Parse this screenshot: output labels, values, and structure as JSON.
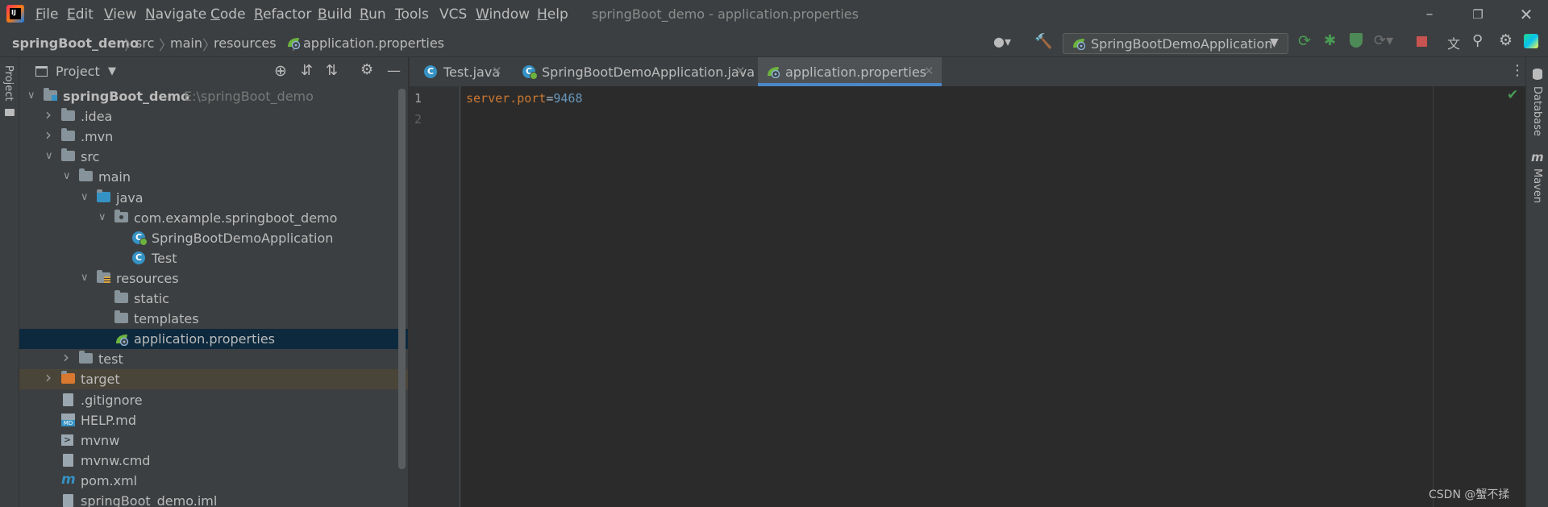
{
  "menu": {
    "items": [
      "File",
      "Edit",
      "View",
      "Navigate",
      "Code",
      "Refactor",
      "Build",
      "Run",
      "Tools",
      "VCS",
      "Window",
      "Help"
    ],
    "mnemonics": [
      "F",
      "E",
      "V",
      "N",
      "C",
      "R",
      "B",
      "R",
      "T",
      "",
      "W",
      "H"
    ]
  },
  "window_title": "springBoot_demo - application.properties",
  "breadcrumbs": [
    "springBoot_demo",
    "src",
    "main",
    "resources",
    "application.properties"
  ],
  "run_config": "SpringBootDemoApplication",
  "left_stripe": {
    "project_label": "Project"
  },
  "right_stripe": {
    "database_label": "Database",
    "maven_label": "Maven"
  },
  "project_panel": {
    "title": "Project",
    "tree": [
      {
        "label": "springBoot_demo",
        "path": "E:\\springBoot_demo",
        "depth": 0,
        "expanded": true,
        "icon": "module-folder-icon"
      },
      {
        "label": ".idea",
        "depth": 1,
        "expanded": false,
        "icon": "folder-icon"
      },
      {
        "label": ".mvn",
        "depth": 1,
        "expanded": false,
        "icon": "folder-icon"
      },
      {
        "label": "src",
        "depth": 1,
        "expanded": true,
        "icon": "folder-icon"
      },
      {
        "label": "main",
        "depth": 2,
        "expanded": true,
        "icon": "folder-icon"
      },
      {
        "label": "java",
        "depth": 3,
        "expanded": true,
        "icon": "source-folder-icon"
      },
      {
        "label": "com.example.springboot_demo",
        "depth": 4,
        "expanded": true,
        "icon": "package-icon"
      },
      {
        "label": "SpringBootDemoApplication",
        "depth": 5,
        "icon": "spring-class-icon"
      },
      {
        "label": "Test",
        "depth": 5,
        "icon": "class-icon"
      },
      {
        "label": "resources",
        "depth": 3,
        "expanded": true,
        "icon": "resource-folder-icon"
      },
      {
        "label": "static",
        "depth": 4,
        "icon": "folder-icon"
      },
      {
        "label": "templates",
        "depth": 4,
        "icon": "folder-icon"
      },
      {
        "label": "application.properties",
        "depth": 4,
        "icon": "spring-properties-icon",
        "selected": true
      },
      {
        "label": "test",
        "depth": 2,
        "expanded": false,
        "icon": "folder-icon"
      },
      {
        "label": "target",
        "depth": 1,
        "expanded": false,
        "icon": "excluded-folder-icon",
        "highlight": true
      },
      {
        "label": ".gitignore",
        "depth": 1,
        "icon": "file-icon"
      },
      {
        "label": "HELP.md",
        "depth": 1,
        "icon": "markdown-icon"
      },
      {
        "label": "mvnw",
        "depth": 1,
        "icon": "shell-icon"
      },
      {
        "label": "mvnw.cmd",
        "depth": 1,
        "icon": "file-icon"
      },
      {
        "label": "pom.xml",
        "depth": 1,
        "icon": "maven-icon"
      },
      {
        "label": "springBoot_demo.iml",
        "depth": 1,
        "icon": "file-icon"
      }
    ]
  },
  "tabs": [
    {
      "label": "Test.java",
      "icon": "class-icon",
      "active": false
    },
    {
      "label": "SpringBootDemoApplication.java",
      "icon": "spring-class-icon",
      "active": false
    },
    {
      "label": "application.properties",
      "icon": "spring-properties-icon",
      "active": true
    }
  ],
  "editor": {
    "line_numbers": [
      "1",
      "2"
    ],
    "lines": [
      {
        "key": "server.port",
        "sep": "=",
        "value": "9468"
      },
      {
        "key": "",
        "sep": "",
        "value": ""
      }
    ]
  },
  "watermark": "CSDN @蟹不揉",
  "colors": {
    "key": "#cc7832",
    "value": "#6897bb",
    "selection": "#0d293e",
    "target_highlight": "#4a4539",
    "active_tab_line": "#4a88c7",
    "ok_check": "#499c54"
  }
}
